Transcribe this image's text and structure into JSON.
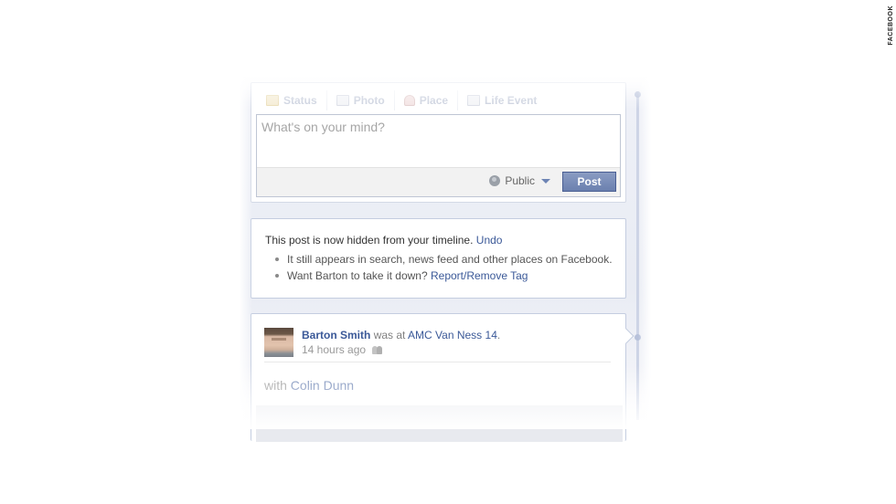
{
  "credit": "FACEBOOK",
  "composer": {
    "tabs": [
      {
        "label": "Status",
        "icon": "status-icon"
      },
      {
        "label": "Photo",
        "icon": "photo-icon"
      },
      {
        "label": "Place",
        "icon": "place-icon"
      },
      {
        "label": "Life Event",
        "icon": "life-event-icon"
      }
    ],
    "placeholder": "What's on your mind?",
    "privacy_label": "Public",
    "post_label": "Post"
  },
  "notice": {
    "text": "This post is now hidden from your timeline.",
    "undo_label": "Undo",
    "bullets": [
      {
        "text": "It still appears in search, news feed and other places on Facebook.",
        "link": ""
      },
      {
        "text": "Want Barton to take it down?",
        "link": "Report/Remove Tag"
      }
    ]
  },
  "post": {
    "author": "Barton Smith",
    "action": "was at",
    "place": "AMC Van Ness 14",
    "time": "14 hours ago",
    "audience_icon": "friends-icon",
    "with_prefix": "with",
    "with_name": "Colin Dunn"
  },
  "colors": {
    "link": "#3b5998",
    "post_button": "#6b80af",
    "spine": "#cdd4e6"
  }
}
